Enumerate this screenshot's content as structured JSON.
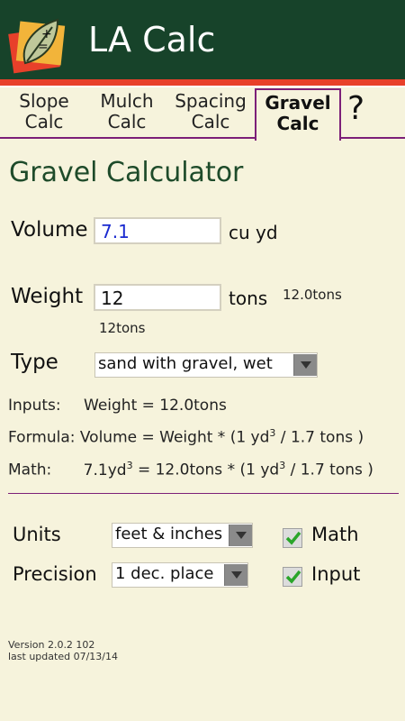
{
  "header": {
    "title": "LA Calc"
  },
  "tabs": [
    {
      "line1": "Slope",
      "line2": "Calc"
    },
    {
      "line1": "Mulch",
      "line2": "Calc"
    },
    {
      "line1": "Spacing",
      "line2": "Calc"
    },
    {
      "line1": "Gravel",
      "line2": "Calc",
      "active": true
    }
  ],
  "help_label": "?",
  "page_title": "Gravel Calculator",
  "volume": {
    "label": "Volume",
    "value": "7.1",
    "unit": "cu yd"
  },
  "weight": {
    "label": "Weight",
    "value": "12",
    "unit": "tons",
    "hint_right": "12.0tons",
    "hint_below": "12tons"
  },
  "type": {
    "label": "Type",
    "selected": "sand with gravel, wet"
  },
  "inputs_line": {
    "label": "Inputs:",
    "text": "Weight = 12.0tons"
  },
  "formula_line": {
    "label": "Formula:",
    "pre": "Volume = Weight * (1 yd",
    "sup": "3",
    "post": " / 1.7 tons )"
  },
  "math_line": {
    "label": "Math:",
    "pre1": "7.1yd",
    "sup1": "3",
    "mid": " = 12.0tons * (1 yd",
    "sup2": "3",
    "post": " / 1.7 tons )"
  },
  "units": {
    "label": "Units",
    "selected": "feet & inches",
    "checkbox_label": "Math",
    "checked": true
  },
  "precision": {
    "label": "Precision",
    "selected": "1 dec. place",
    "checkbox_label": "Input",
    "checked": true
  },
  "footer": {
    "version": "Version 2.0.2 102",
    "updated": "last updated 07/13/14"
  },
  "colors": {
    "header": "#17432a",
    "accent_red": "#e8402a",
    "tab_border": "#7c1f78",
    "title_green": "#1e4b2a",
    "background": "#f6f3dc"
  }
}
